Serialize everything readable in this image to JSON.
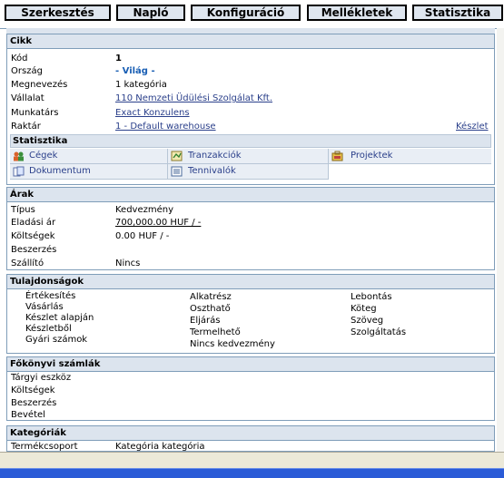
{
  "tabs": [
    "Szerkesztés",
    "Napló",
    "Konfiguráció",
    "Mellékletek",
    "Statisztika"
  ],
  "cikk": {
    "title": "Cikk",
    "rows": [
      {
        "label": "Kód",
        "value": "1"
      },
      {
        "label": "Ország",
        "value": "- Világ -"
      },
      {
        "label": "Megnevezés",
        "value": "1 kategória"
      },
      {
        "label": "Vállalat",
        "value": "110 Nemzeti Üdülési Szolgálat Kft."
      },
      {
        "label": "Munkatárs",
        "value": "Exact Konzulens"
      },
      {
        "label": "Raktár",
        "value": "1 - Default warehouse"
      }
    ],
    "keszlet_link": "Készlet",
    "stats_title": "Statisztika",
    "stats": [
      {
        "label": "Cégek",
        "icon": "companies-icon"
      },
      {
        "label": "Tranzakciók",
        "icon": "transactions-icon"
      },
      {
        "label": "Projektek",
        "icon": "projects-icon"
      },
      {
        "label": "Dokumentum",
        "icon": "documents-icon"
      },
      {
        "label": "Tennivalók",
        "icon": "todo-icon"
      }
    ]
  },
  "arak": {
    "title": "Árak",
    "rows": [
      {
        "label": "Típus",
        "value": "Kedvezmény"
      },
      {
        "label": "Eladási ár",
        "value": "700,000.00 HUF / -"
      },
      {
        "label": "Költségek",
        "value": "0.00 HUF / -"
      },
      {
        "label": "Beszerzés",
        "value": ""
      },
      {
        "label": "Szállító",
        "value": "Nincs"
      }
    ]
  },
  "tulajdonsagok": {
    "title": "Tulajdonságok",
    "col1": [
      "Értékesítés",
      "Vásárlás",
      "Készlet alapján",
      "Készletből",
      "Gyári számok"
    ],
    "col2": [
      "Alkatrész",
      "Oszthatő",
      "Eljárás",
      "Termelhető",
      "Nincs kedvezmény"
    ],
    "col3": [
      "Lebontás",
      "Köteg",
      "Szöveg",
      "Szolgáltatás"
    ]
  },
  "fokonyvi": {
    "title": "Főkönyvi számlák",
    "rows": [
      "Tárgyi eszköz",
      "Költségek",
      "Beszerzés",
      "Bevétel"
    ]
  },
  "kategoriak": {
    "title": "Kategóriák",
    "partial_label": "Termékcsoport",
    "partial_value": "Kategória kategória"
  }
}
